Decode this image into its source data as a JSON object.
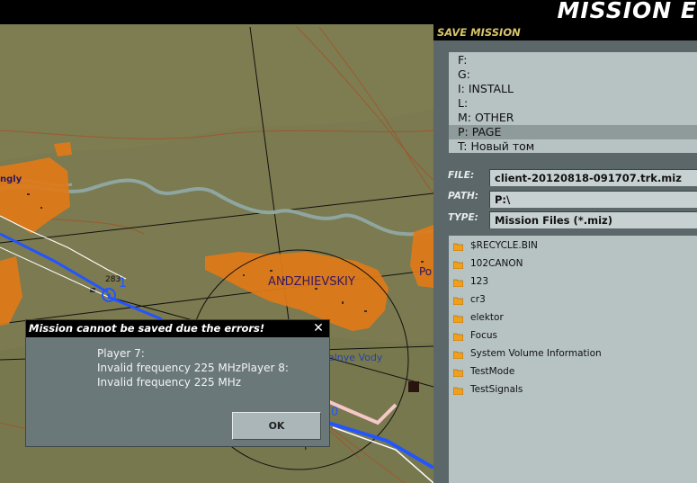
{
  "app": {
    "title": "MISSION E"
  },
  "panel": {
    "title": "SAVE MISSION"
  },
  "drives": [
    {
      "label": "F:",
      "selected": false
    },
    {
      "label": "G:",
      "selected": false
    },
    {
      "label": "I: INSTALL",
      "selected": false
    },
    {
      "label": "L:",
      "selected": false
    },
    {
      "label": "M: OTHER",
      "selected": false
    },
    {
      "label": "P: PAGE",
      "selected": true
    },
    {
      "label": "T: Новый том",
      "selected": false
    }
  ],
  "form": {
    "file_label": "FILE:",
    "file_value": "client-20120818-091707.trk.miz",
    "path_label": "PATH:",
    "path_value": "P:\\",
    "type_label": "TYPE:",
    "type_value": "Mission Files (*.miz)"
  },
  "files": [
    {
      "label": "$RECYCLE.BIN"
    },
    {
      "label": "102CANON"
    },
    {
      "label": "123"
    },
    {
      "label": "cr3"
    },
    {
      "label": "elektor"
    },
    {
      "label": "Focus"
    },
    {
      "label": "System Volume Information"
    },
    {
      "label": "TestMode"
    },
    {
      "label": "TestSignals"
    }
  ],
  "map": {
    "labels": {
      "town_main": "ANDZHIEVSKIY",
      "town_left": "ngly",
      "town_water": "alnye Vody",
      "town_right": "Po",
      "elevation": "283",
      "waypoint_number": "1",
      "waypoint_zero": "0"
    }
  },
  "dialog": {
    "title": "Mission cannot be saved due the errors!",
    "message": "Player 7:\nInvalid frequency 225 MHzPlayer 8:\nInvalid frequency 225 MHz",
    "ok_label": "OK"
  },
  "colors": {
    "terrain": "#7a7a52",
    "town": "#e07a18",
    "river": "#8fa6a0",
    "route": "#2255ff",
    "panel": "#5b6769",
    "list_bg": "#b7c2c3",
    "dialog_bg": "#6b787a"
  },
  "icons": {
    "folder": "folder-icon",
    "close": "close-icon",
    "waypoint": "waypoint-icon"
  }
}
